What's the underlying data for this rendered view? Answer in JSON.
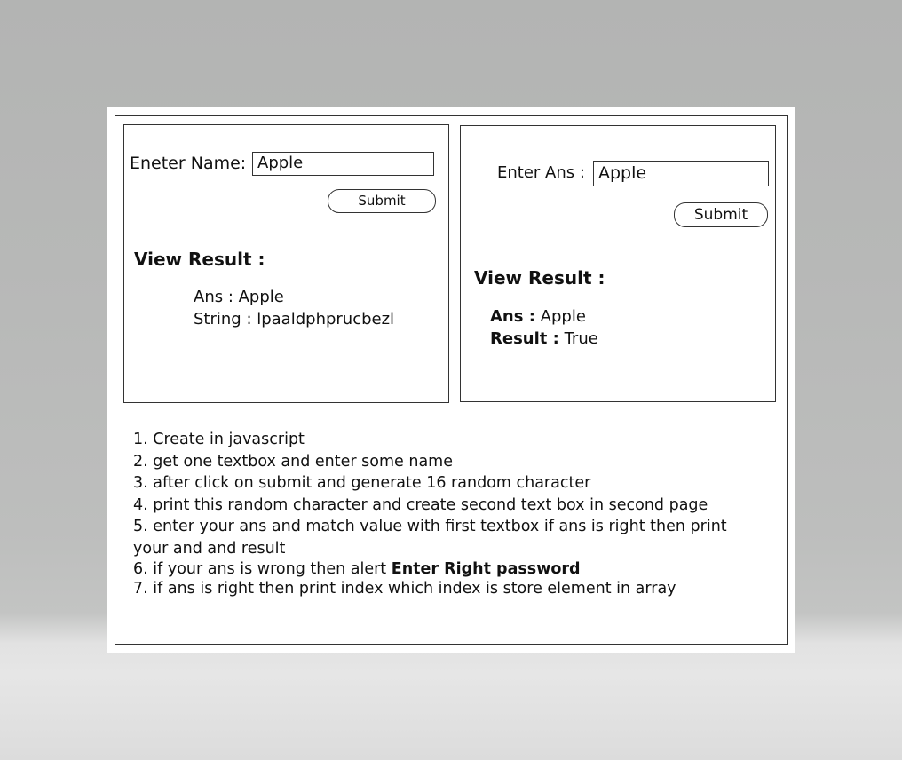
{
  "left_panel": {
    "name_label": "Eneter Name:",
    "name_value": "Apple",
    "submit_label": "Submit",
    "view_result_label": "View Result :",
    "ans_line": "Ans : Apple",
    "string_line": "String : lpaaldphprucbezl"
  },
  "right_panel": {
    "ans_label": "Enter Ans :",
    "ans_value": "Apple",
    "submit_label": "Submit",
    "view_result_label": "View Result :",
    "ans_key": "Ans :",
    "ans_val": "Apple",
    "result_key": "Result :",
    "result_val": "True"
  },
  "instructions": [
    "1. Create in javascript",
    "2. get one textbox and enter some name",
    "3. after click on submit and generate 16 random character",
    "4. print this random character and create second text box in second page",
    "5. enter your ans and match value with first textbox if ans is right then print your and and result"
  ],
  "instruction_6": {
    "text": "6. if your ans is wrong then alert",
    "bold": "Enter Right password"
  },
  "instruction_7": "7. if ans is right then print index which index is store element in array"
}
